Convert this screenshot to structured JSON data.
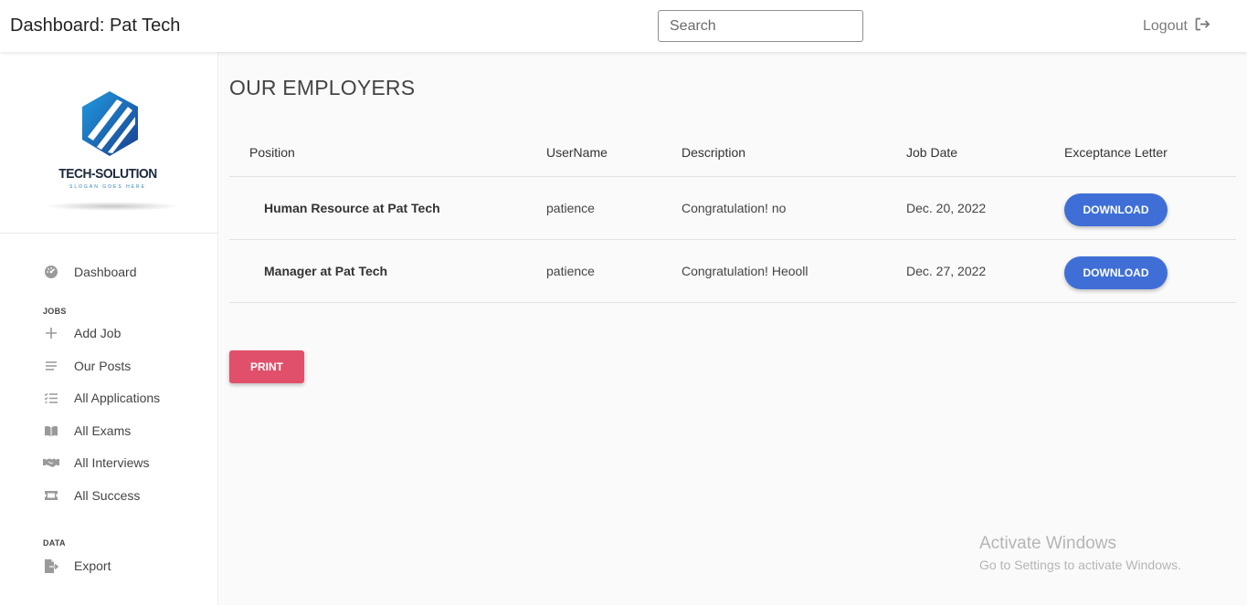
{
  "header": {
    "title": "Dashboard: Pat Tech",
    "search_placeholder": "Search",
    "logout_label": "Logout"
  },
  "logo": {
    "brand": "TECH-SOLUTION",
    "slogan": "SLOGAN GOES HERE"
  },
  "sidebar": {
    "dashboard": {
      "label": "Dashboard",
      "icon": "dashboard-gauge-icon"
    },
    "sections": [
      {
        "title": "JOBS"
      },
      {
        "title": "DATA"
      }
    ],
    "items": [
      {
        "label": "Add Job",
        "icon": "plus-icon"
      },
      {
        "label": "Our Posts",
        "icon": "list-icon"
      },
      {
        "label": "All Applications",
        "icon": "checklist-icon"
      },
      {
        "label": "All Exams",
        "icon": "book-icon"
      },
      {
        "label": "All Interviews",
        "icon": "handshake-icon"
      },
      {
        "label": "All Success",
        "icon": "ticket-icon"
      },
      {
        "label": "Export",
        "icon": "file-export-icon"
      }
    ]
  },
  "main": {
    "title": "OUR EMPLOYERS",
    "columns": [
      "Position",
      "UserName",
      "Description",
      "Job Date",
      "Exceptance Letter"
    ],
    "rows": [
      {
        "position": "Human Resource at Pat Tech",
        "username": "patience",
        "description": "Congratulation! no",
        "job_date": "Dec. 20, 2022",
        "action": "DOWNLOAD"
      },
      {
        "position": "Manager at Pat Tech",
        "username": "patience",
        "description": "Congratulation! Heooll",
        "job_date": "Dec. 27, 2022",
        "action": "DOWNLOAD"
      }
    ],
    "print_label": "PRINT"
  },
  "watermark": {
    "line1": "Activate Windows",
    "line2": "Go to Settings to activate Windows."
  },
  "colors": {
    "download": "#3f6fd6",
    "print": "#e0506a"
  }
}
